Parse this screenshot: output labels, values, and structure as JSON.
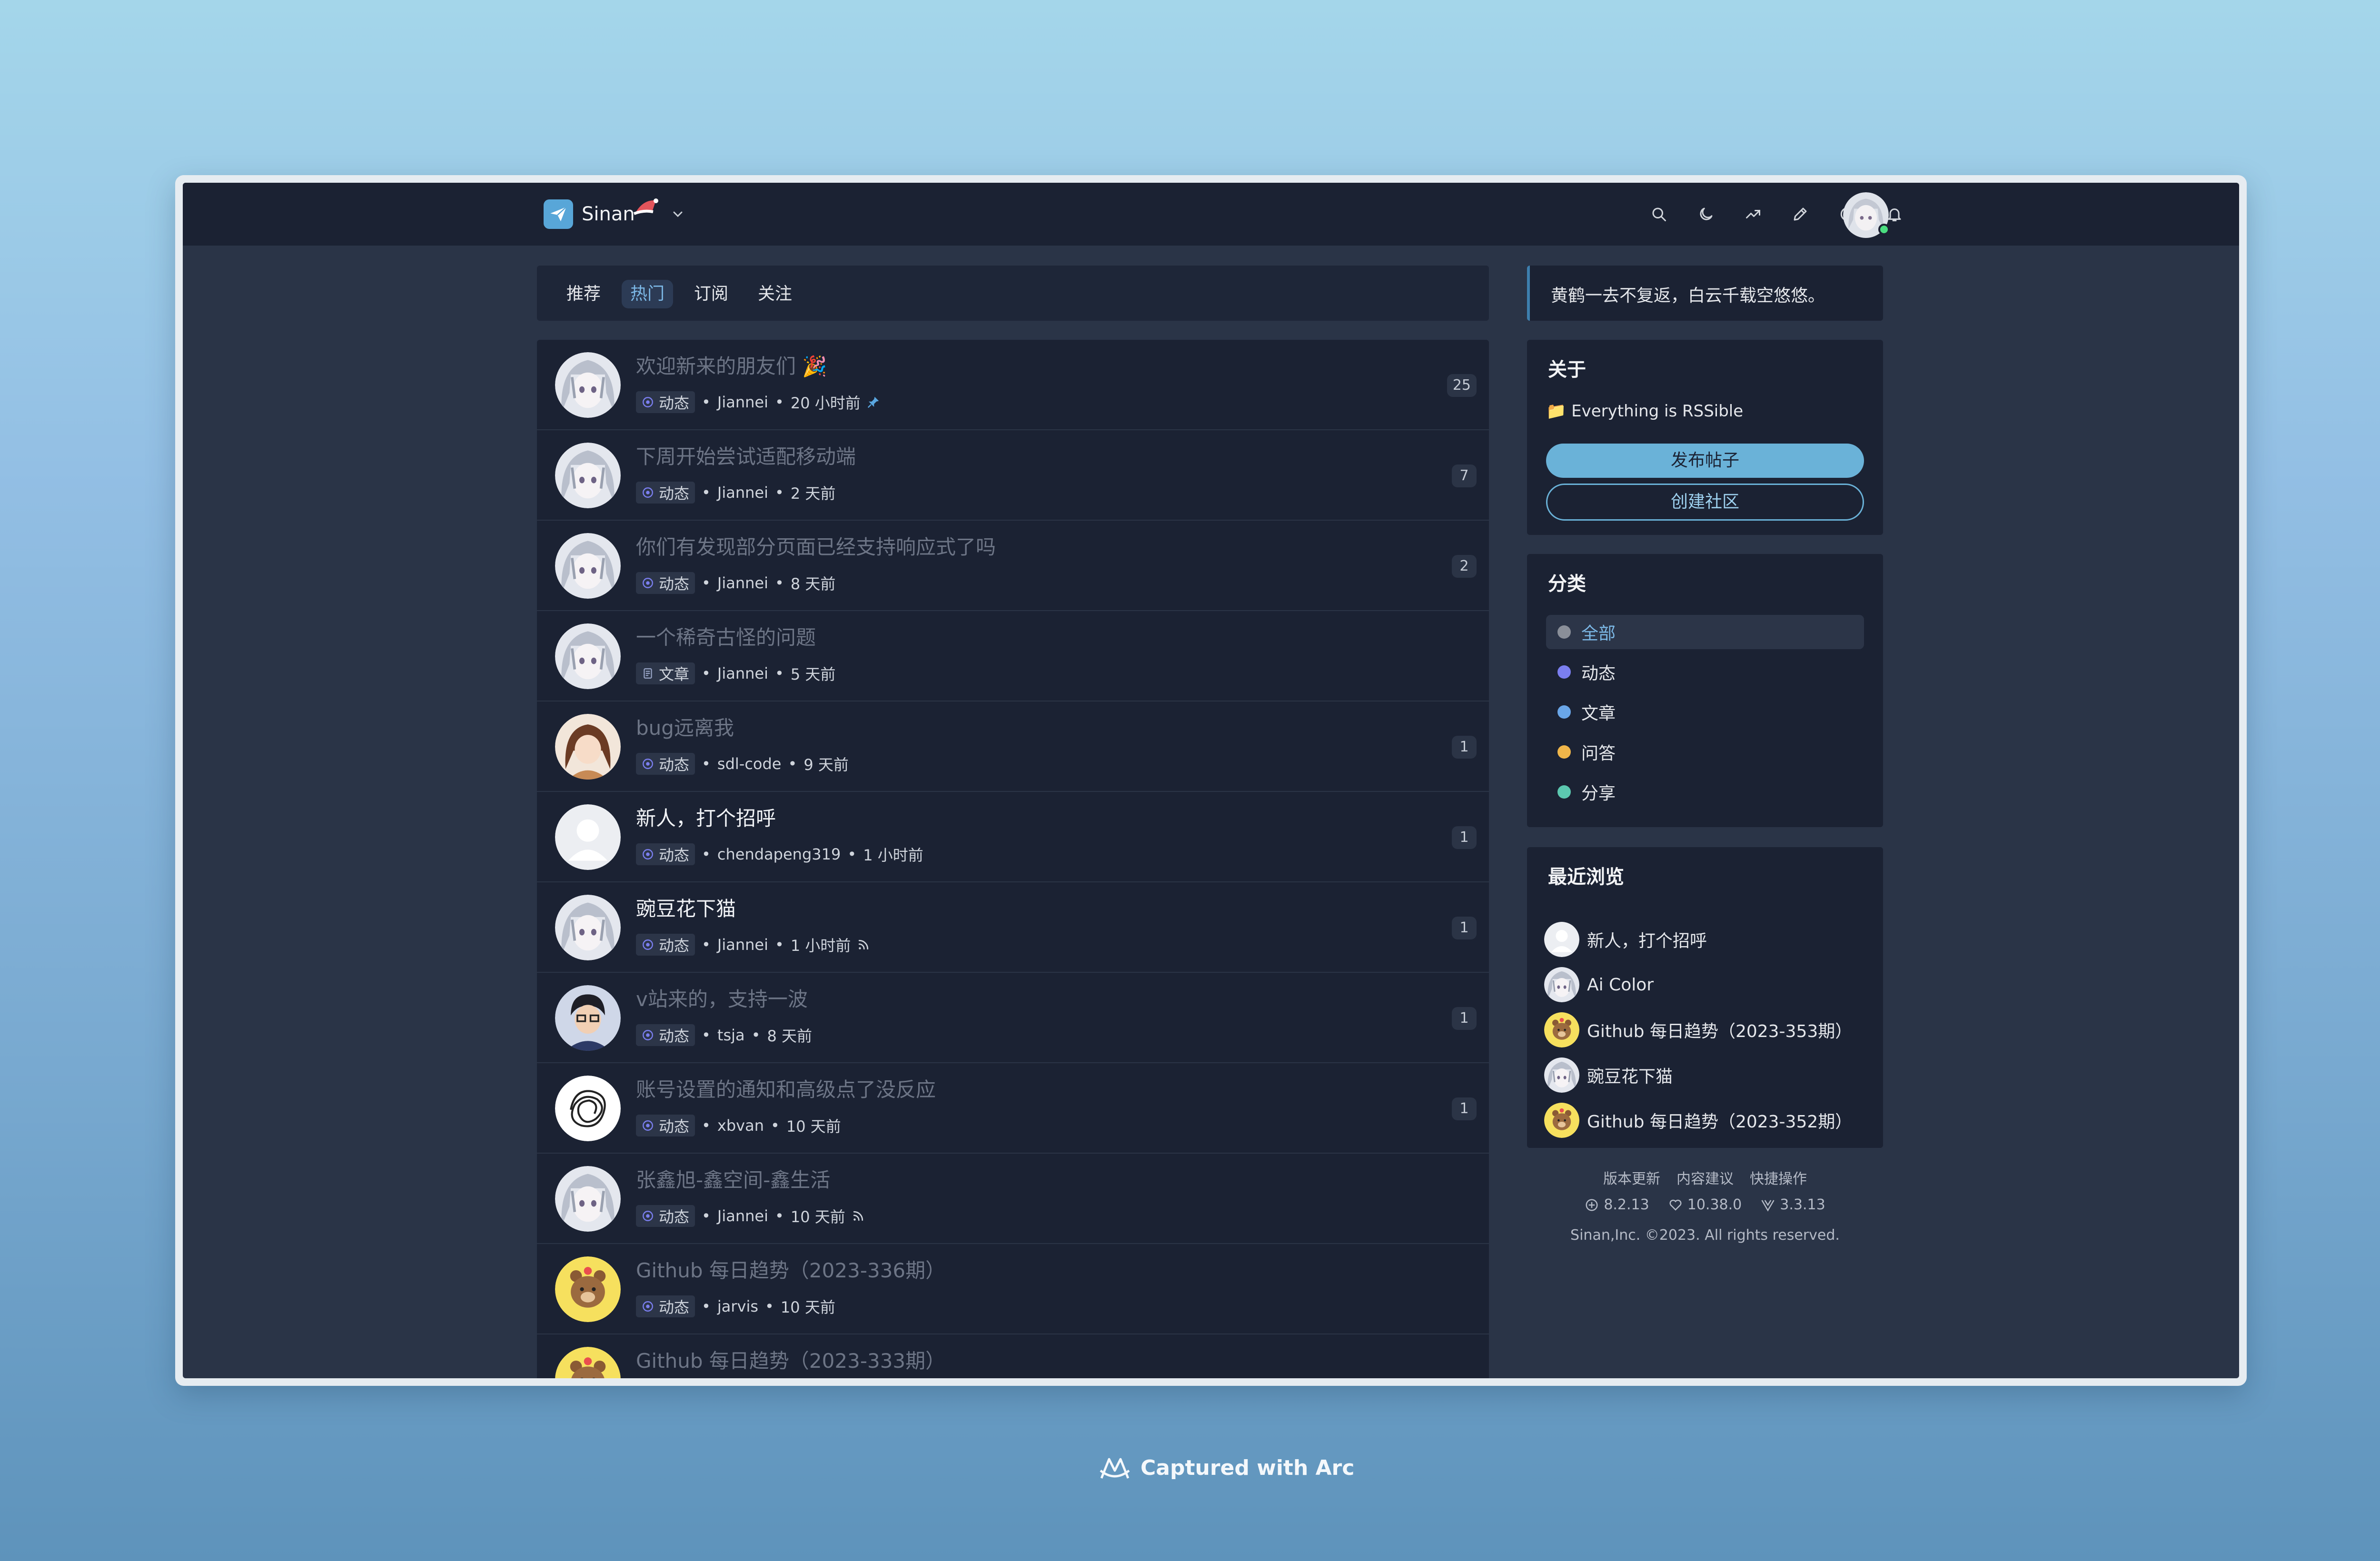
{
  "app": {
    "name": "Sinan",
    "nav_tabs": [
      "推荐",
      "热门",
      "订阅",
      "关注"
    ],
    "active_tab": "热门"
  },
  "header_icons": [
    "search-icon",
    "moon-icon",
    "trending-icon",
    "pen-icon",
    "dashboard-icon",
    "bell-icon",
    "user-avatar"
  ],
  "posts": [
    {
      "title": "欢迎新来的朋友们 🎉",
      "tag": "动态",
      "author": "Jiannei",
      "time": "20 小时前",
      "count": "25",
      "extra": "pin-icon",
      "avatar": "anime-girl",
      "unread": false
    },
    {
      "title": "下周开始尝试适配移动端",
      "tag": "动态",
      "author": "Jiannei",
      "time": "2 天前",
      "count": "7",
      "extra": "",
      "avatar": "anime-girl",
      "unread": false
    },
    {
      "title": "你们有发现部分页面已经支持响应式了吗",
      "tag": "动态",
      "author": "Jiannei",
      "time": "8 天前",
      "count": "2",
      "extra": "",
      "avatar": "anime-girl",
      "unread": false
    },
    {
      "title": "一个稀奇古怪的问题",
      "tag": "文章",
      "author": "Jiannei",
      "time": "5 天前",
      "count": "",
      "extra": "",
      "avatar": "anime-girl",
      "unread": false
    },
    {
      "title": "bug远离我",
      "tag": "动态",
      "author": "sdl-code",
      "time": "9 天前",
      "count": "1",
      "extra": "",
      "avatar": "brown-hair",
      "unread": false
    },
    {
      "title": "新人，打个招呼",
      "tag": "动态",
      "author": "chendapeng319",
      "time": "1 小时前",
      "count": "1",
      "extra": "",
      "avatar": "default",
      "unread": true
    },
    {
      "title": "豌豆花下猫",
      "tag": "动态",
      "author": "Jiannei",
      "time": "1 小时前",
      "count": "1",
      "extra": "rss-icon",
      "avatar": "anime-girl",
      "unread": true
    },
    {
      "title": "v站来的，支持一波",
      "tag": "动态",
      "author": "tsja",
      "time": "8 天前",
      "count": "1",
      "extra": "",
      "avatar": "person-glasses",
      "unread": false
    },
    {
      "title": "账号设置的通知和高级点了没反应",
      "tag": "动态",
      "author": "xbvan",
      "time": "10 天前",
      "count": "1",
      "extra": "",
      "avatar": "scribble",
      "unread": false
    },
    {
      "title": "张鑫旭-鑫空间-鑫生活",
      "tag": "动态",
      "author": "Jiannei",
      "time": "10 天前",
      "count": "",
      "extra": "rss-icon",
      "avatar": "anime-girl",
      "unread": false
    },
    {
      "title": "Github 每日趋势（2023-336期）",
      "tag": "动态",
      "author": "jarvis",
      "time": "10 天前",
      "count": "",
      "extra": "",
      "avatar": "bear",
      "unread": false
    },
    {
      "title": "Github 每日趋势（2023-333期）",
      "tag": "",
      "author": "",
      "time": "",
      "count": "",
      "extra": "",
      "avatar": "bear",
      "unread": false
    }
  ],
  "sidebar": {
    "quote": "黄鹤一去不复返，白云千载空悠悠。",
    "about": {
      "title": "关于",
      "desc": "📁 Everything is RSSible",
      "primary_button": "发布帖子",
      "secondary_button": "创建社区"
    },
    "categories": {
      "title": "分类",
      "items": [
        {
          "label": "全部",
          "color": "#8a8f99",
          "active": true
        },
        {
          "label": "动态",
          "color": "#7b7ff0",
          "active": false
        },
        {
          "label": "文章",
          "color": "#6aa6e8",
          "active": false
        },
        {
          "label": "问答",
          "color": "#f0b64a",
          "active": false
        },
        {
          "label": "分享",
          "color": "#5cc8b0",
          "active": false
        }
      ]
    },
    "recent": {
      "title": "最近浏览",
      "items": [
        {
          "label": "新人，打个招呼",
          "avatar": "default"
        },
        {
          "label": "Ai Color",
          "avatar": "anime-girl"
        },
        {
          "label": "Github 每日趋势（2023-353期）",
          "avatar": "bear"
        },
        {
          "label": "豌豆花下猫",
          "avatar": "anime-girl"
        },
        {
          "label": "Github 每日趋势（2023-352期）",
          "avatar": "bear"
        }
      ]
    }
  },
  "footer": {
    "links": [
      "版本更新",
      "内容建议",
      "快捷操作"
    ],
    "versions": [
      "8.2.13",
      "10.38.0",
      "3.3.13"
    ],
    "copyright": "Sinan,Inc. ©2023. All rights reserved."
  },
  "watermark": "Captured with Arc",
  "colors": {
    "accent": "#6ab2d8",
    "card_bg": "#1b2233",
    "page_bg": "#2a3447"
  }
}
